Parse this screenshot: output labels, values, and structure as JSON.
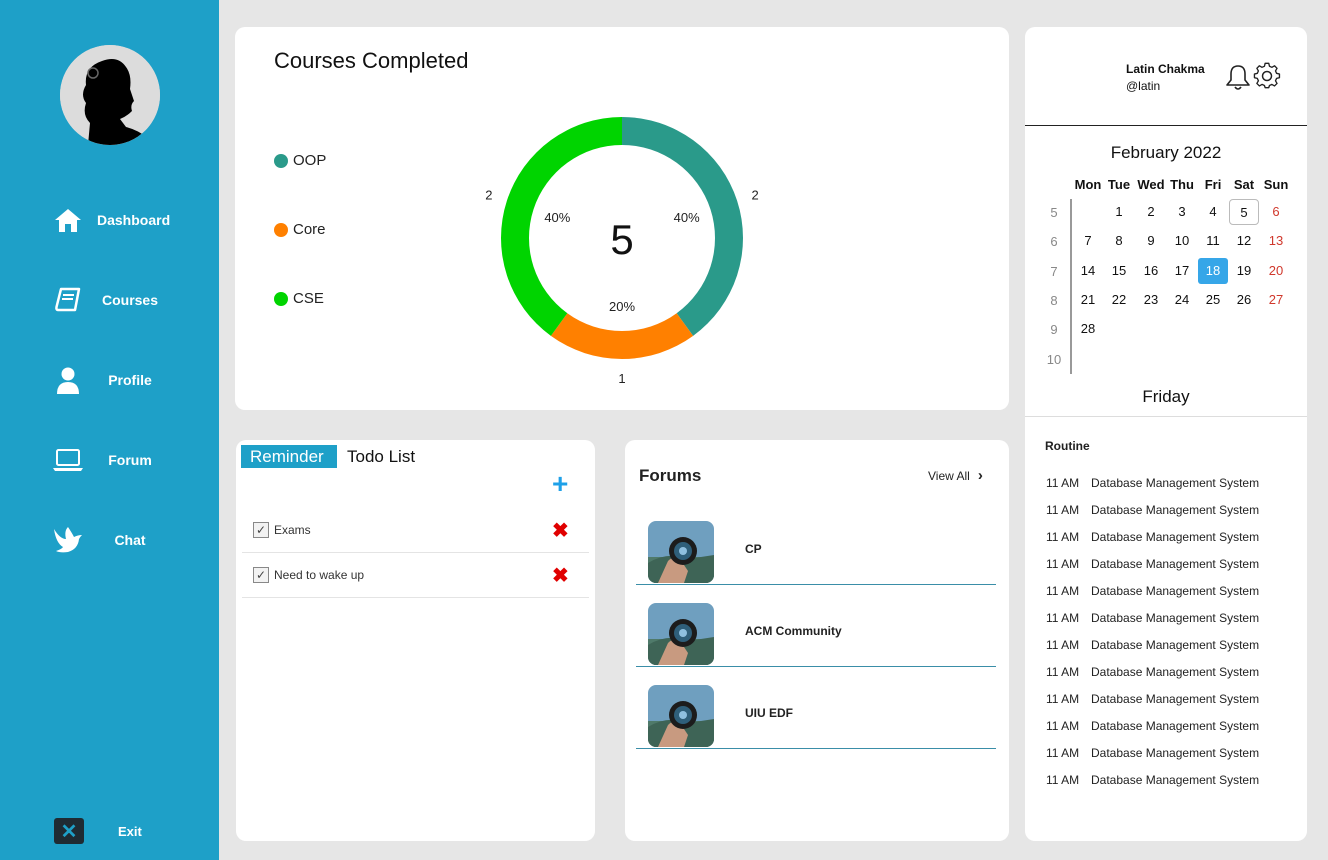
{
  "sidebar": {
    "items": [
      {
        "label": "Dashboard",
        "icon": "home-icon"
      },
      {
        "label": "Courses",
        "icon": "book-icon"
      },
      {
        "label": "Profile",
        "icon": "user-icon"
      },
      {
        "label": "Forum",
        "icon": "laptop-icon"
      },
      {
        "label": "Chat",
        "icon": "bird-icon"
      }
    ],
    "exit_label": "Exit"
  },
  "courses": {
    "title": "Courses Completed",
    "total": "5",
    "legend": [
      "OOP",
      "Core",
      "CSE"
    ]
  },
  "chart_data": {
    "type": "pie",
    "title": "Courses Completed",
    "center_value": 5,
    "categories": [
      "OOP",
      "Core",
      "CSE"
    ],
    "values": [
      2,
      1,
      2
    ],
    "percent_labels": [
      "40%",
      "20%",
      "40%"
    ],
    "colors": [
      "#2a9a8a",
      "#ff8000",
      "#00d400"
    ],
    "legend_position": "left"
  },
  "reminder": {
    "tab_reminder": "Reminder",
    "tab_todo": "Todo List",
    "items": [
      {
        "text": "Exams",
        "checked": true
      },
      {
        "text": "Need to wake up",
        "checked": true
      }
    ]
  },
  "forums": {
    "title": "Forums",
    "view_all": "View All",
    "items": [
      "CP",
      "ACM Community",
      "UIU EDF"
    ]
  },
  "user": {
    "name": "Latin Chakma",
    "handle": "@latin"
  },
  "calendar": {
    "title": "February 2022",
    "headers": [
      "Mon",
      "Tue",
      "Wed",
      "Thu",
      "Fri",
      "Sat",
      "Sun"
    ],
    "weeks": [
      "5",
      "6",
      "7",
      "8",
      "9",
      "10"
    ],
    "rows": [
      [
        "",
        "1",
        "2",
        "3",
        "4",
        "5",
        "6"
      ],
      [
        "7",
        "8",
        "9",
        "10",
        "11",
        "12",
        "13"
      ],
      [
        "14",
        "15",
        "16",
        "17",
        "18",
        "19",
        "20"
      ],
      [
        "21",
        "22",
        "23",
        "24",
        "25",
        "26",
        "27"
      ],
      [
        "28",
        "",
        "",
        "",
        "",
        "",
        ""
      ],
      [
        "",
        "",
        "",
        "",
        "",
        "",
        ""
      ]
    ],
    "today": "18",
    "boxed": "5",
    "accent": "#36a6e8",
    "weekend_color": "#d0382c",
    "day_name": "Friday"
  },
  "routine": {
    "title": "Routine",
    "items": [
      {
        "time": "11 AM",
        "course": "Database Management System"
      },
      {
        "time": "11 AM",
        "course": "Database Management System"
      },
      {
        "time": "11 AM",
        "course": "Database Management System"
      },
      {
        "time": "11 AM",
        "course": "Database Management System"
      },
      {
        "time": "11 AM",
        "course": "Database Management System"
      },
      {
        "time": "11 AM",
        "course": "Database Management System"
      },
      {
        "time": "11 AM",
        "course": "Database Management System"
      },
      {
        "time": "11 AM",
        "course": "Database Management System"
      },
      {
        "time": "11 AM",
        "course": "Database Management System"
      },
      {
        "time": "11 AM",
        "course": "Database Management System"
      },
      {
        "time": "11 AM",
        "course": "Database Management System"
      },
      {
        "time": "11 AM",
        "course": "Database Management System"
      }
    ]
  }
}
